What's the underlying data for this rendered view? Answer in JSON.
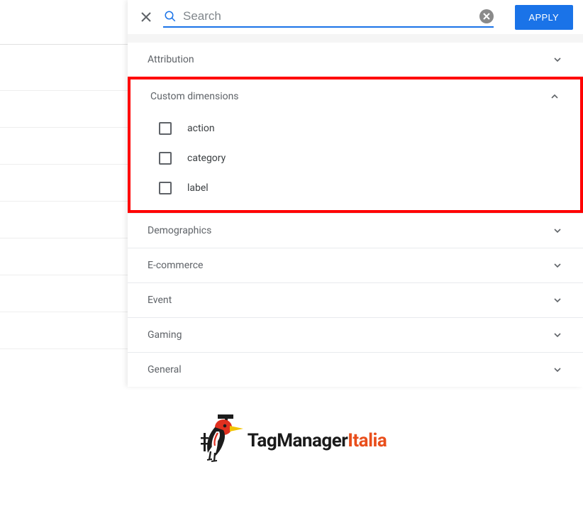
{
  "search": {
    "placeholder": "Search"
  },
  "apply_label": "APPLY",
  "sections": {
    "attribution": "Attribution",
    "custom_dimensions": "Custom dimensions",
    "demographics": "Demographics",
    "ecommerce": "E-commerce",
    "event": "Event",
    "gaming": "Gaming",
    "general": "General"
  },
  "custom_dim_items": {
    "action": "action",
    "category": "category",
    "label": "label"
  },
  "logo": {
    "tagmanager": "TagManager",
    "italia": "Italia"
  }
}
